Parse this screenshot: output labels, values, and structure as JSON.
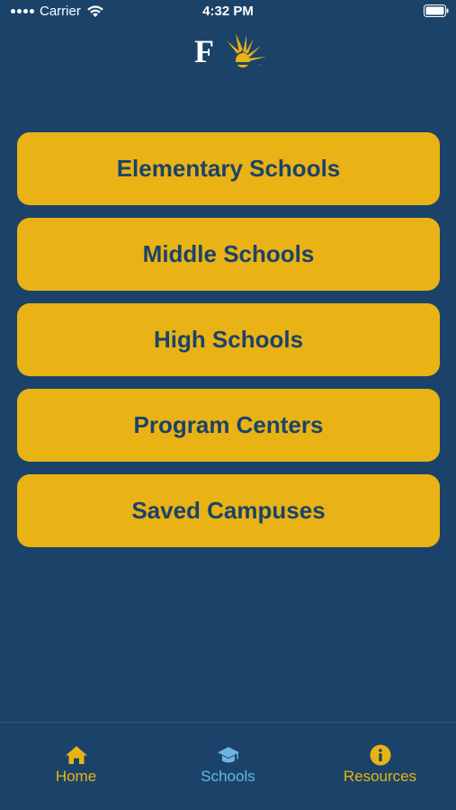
{
  "status_bar": {
    "carrier": "Carrier",
    "time": "4:32 PM"
  },
  "logo": {
    "letter": "F"
  },
  "menu": {
    "items": [
      {
        "label": "Elementary Schools"
      },
      {
        "label": "Middle Schools"
      },
      {
        "label": "High Schools"
      },
      {
        "label": "Program Centers"
      },
      {
        "label": "Saved Campuses"
      }
    ]
  },
  "tab_bar": {
    "tabs": [
      {
        "label": "Home",
        "icon": "home-icon",
        "active": false
      },
      {
        "label": "Schools",
        "icon": "graduation-cap-icon",
        "active": true
      },
      {
        "label": "Resources",
        "icon": "info-icon",
        "active": false
      }
    ]
  },
  "colors": {
    "background": "#1b4369",
    "button": "#e9b215",
    "button_text": "#1b4369",
    "tab_inactive": "#e9b215",
    "tab_active": "#6db4e4"
  }
}
